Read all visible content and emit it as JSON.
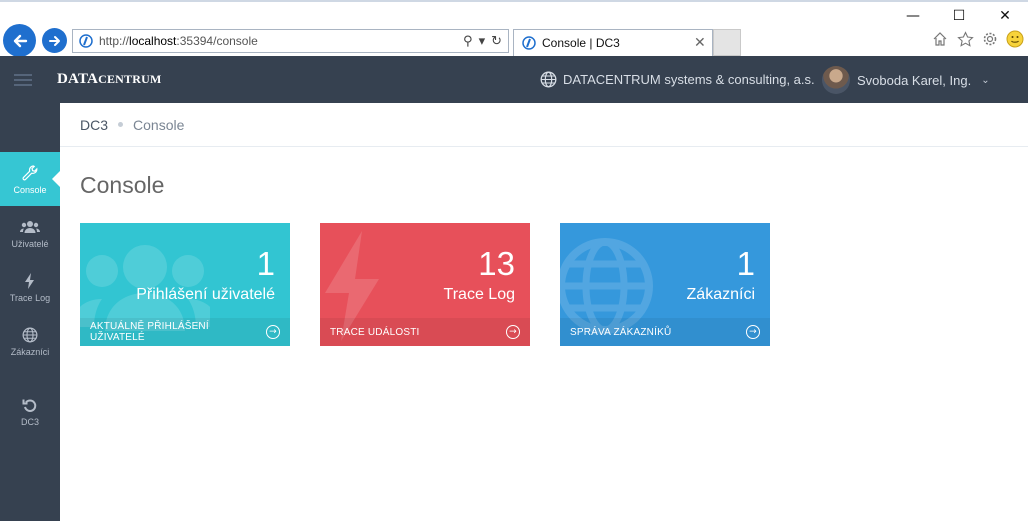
{
  "browser": {
    "url_prefix": "http://",
    "url_host": "localhost",
    "url_rest": ":35394/console",
    "tab_title": "Console | DC3",
    "window_controls": [
      "minimize",
      "maximize",
      "close"
    ]
  },
  "header": {
    "brand_main": "DATA",
    "brand_rest": "CENTRUM",
    "company": "DATACENTRUM systems & consulting, a.s.",
    "user": "Svoboda Karel, Ing."
  },
  "sidebar": {
    "items": [
      {
        "label": "Console",
        "icon": "wrench-icon",
        "active": true
      },
      {
        "label": "Uživatelé",
        "icon": "users-icon",
        "active": false
      },
      {
        "label": "Trace Log",
        "icon": "bolt-icon",
        "active": false
      },
      {
        "label": "Zákazníci",
        "icon": "globe-icon",
        "active": false
      },
      {
        "label": "DC3",
        "icon": "undo-icon",
        "active": false
      }
    ]
  },
  "breadcrumb": {
    "root": "DC3",
    "current": "Console"
  },
  "page": {
    "title": "Console"
  },
  "tiles": [
    {
      "number": "1",
      "title": "Přihlášení uživatelé",
      "link": "AKTUÁLNĚ PŘIHLÁŠENÍ UŽIVATELÉ",
      "color": "#32c5d2",
      "icon": "users-icon"
    },
    {
      "number": "13",
      "title": "Trace Log",
      "link": "TRACE UDÁLOSTI",
      "color": "#e7505a",
      "icon": "bolt-icon"
    },
    {
      "number": "1",
      "title": "Zákazníci",
      "link": "SPRÁVA ZÁKAZNÍKŮ",
      "color": "#3598dc",
      "icon": "globe-icon"
    }
  ],
  "colors": {
    "sidebar": "#364150",
    "active": "#36c6d3",
    "browser_accent": "#1f6fce"
  }
}
